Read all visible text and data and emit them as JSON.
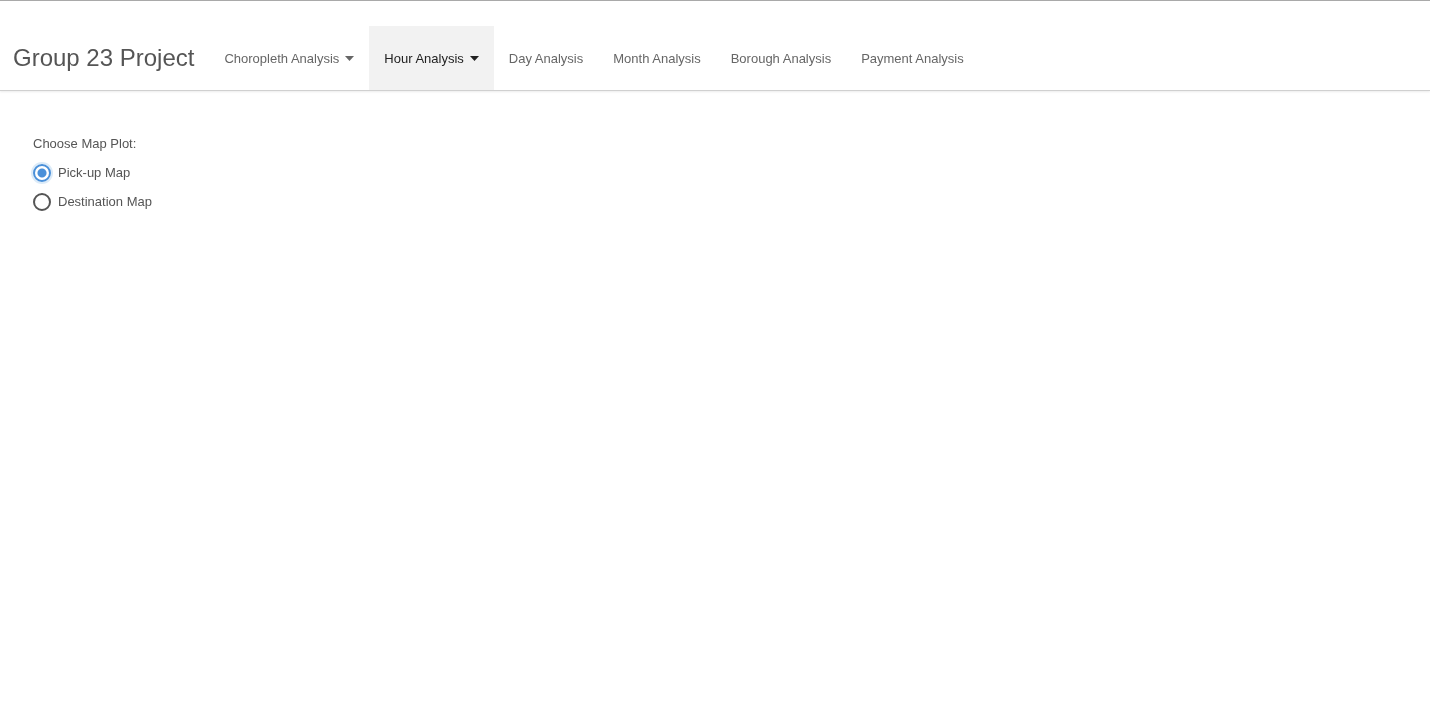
{
  "navbar": {
    "brand": "Group 23 Project",
    "tabs": [
      {
        "label": "Choropleth Analysis",
        "kind": "dropdown",
        "selected": false
      },
      {
        "label": "Hour Analysis",
        "kind": "dropdown",
        "selected": true
      },
      {
        "label": "Day Analysis",
        "kind": "link",
        "selected": false
      },
      {
        "label": "Month Analysis",
        "kind": "link",
        "selected": false
      },
      {
        "label": "Borough Analysis",
        "kind": "link",
        "selected": false
      },
      {
        "label": "Payment Analysis",
        "kind": "link",
        "selected": false
      }
    ]
  },
  "map_choice": {
    "label": "Choose Map Plot:",
    "options": [
      {
        "label": "Pick-up Map",
        "selected": true
      },
      {
        "label": "Destination Map",
        "selected": false
      }
    ]
  }
}
